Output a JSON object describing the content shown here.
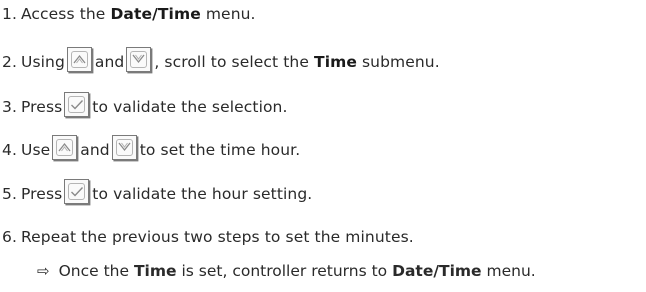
{
  "steps": [
    {
      "num": "1.",
      "t1": "Access the",
      "b1": "Date/Time",
      "t2": "menu."
    },
    {
      "num": "2.",
      "t1": "Using",
      "t2": "and",
      "t3": ", scroll to select the",
      "b1": "Time",
      "t4": "submenu."
    },
    {
      "num": "3.",
      "t1": "Press",
      "t2": "to validate the selection."
    },
    {
      "num": "4.",
      "t1": "Use",
      "t2": "and",
      "t3": "to set the time hour."
    },
    {
      "num": "5.",
      "t1": "Press",
      "t2": "to validate the hour setting."
    },
    {
      "num": "6.",
      "t1": "Repeat the previous two steps to set the minutes."
    }
  ],
  "result": {
    "arrow": "⇨",
    "t1": "Once the",
    "b1": "Time",
    "t2": "is set, controller returns to",
    "b2": "Date/Time",
    "t3": "menu."
  },
  "icons": {
    "up": "up-arrow-key-icon",
    "down": "down-arrow-key-icon",
    "check": "check-key-icon"
  }
}
